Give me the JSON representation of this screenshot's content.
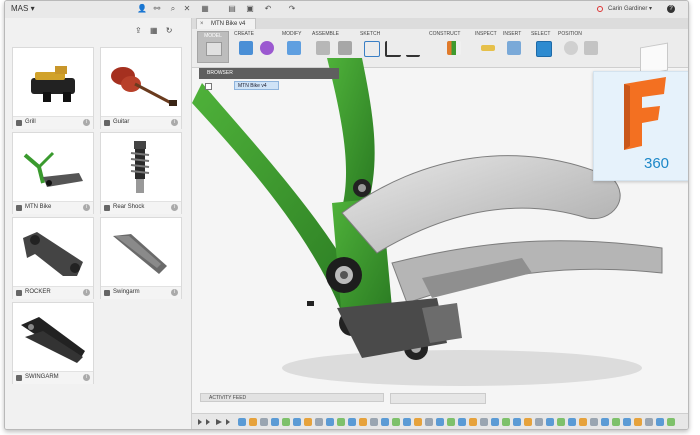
{
  "topbar": {
    "project_name": "MAS",
    "user_name": "Carin Gardiner"
  },
  "document_tab": {
    "title": "MTN Bike v4"
  },
  "ribbon": {
    "model_label": "MODEL",
    "groups": [
      "CREATE",
      "MODIFY",
      "ASSEMBLE",
      "SKETCH",
      "CONSTRUCT",
      "INSPECT",
      "INSERT",
      "SELECT",
      "POSITION"
    ]
  },
  "browser": {
    "title": "BROWSER",
    "root_item": "MTN Bike v4"
  },
  "library": {
    "cards": [
      {
        "label": "Grill"
      },
      {
        "label": "Guitar"
      },
      {
        "label": "MTN Bike"
      },
      {
        "label": "Rear Shock"
      },
      {
        "label": "ROCKER"
      },
      {
        "label": "Swingarm"
      },
      {
        "label": "SWINGARM"
      }
    ]
  },
  "activity_feed": {
    "label": "ACTIVITY FEED"
  },
  "logo": {
    "text": "360",
    "accent_color": "#f37021",
    "text_color": "#1d88c8"
  },
  "colors": {
    "frame_green": "#3f9a2e",
    "selection_blue": "#cfe3f7",
    "panel_bg": "#f1f1f1"
  }
}
